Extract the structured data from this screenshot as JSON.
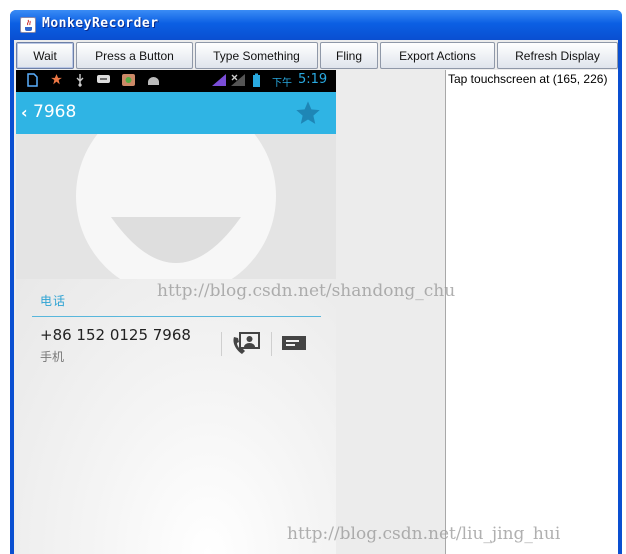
{
  "window": {
    "title": "MonkeyRecorder"
  },
  "toolbar": {
    "buttons": [
      {
        "label": "Wait"
      },
      {
        "label": "Press a Button"
      },
      {
        "label": "Type Something"
      },
      {
        "label": "Fling"
      },
      {
        "label": "Export Actions"
      },
      {
        "label": "Refresh Display"
      }
    ]
  },
  "device": {
    "status_bar": {
      "time_prefix": "下午",
      "time": "5:19"
    },
    "action_bar": {
      "contact_name": "7968"
    },
    "section_header": "电话",
    "phone": {
      "number": "+86 152 0125 7968",
      "type": "手机"
    },
    "colors": {
      "accent": "#2fb4e4",
      "statusbar": "#000000"
    }
  },
  "log": {
    "lines": [
      "Tap touchscreen at (165, 226)"
    ]
  },
  "watermarks": [
    "http://blog.csdn.net/shandong_chu",
    "http://blog.csdn.net/liu_jing_hui"
  ]
}
